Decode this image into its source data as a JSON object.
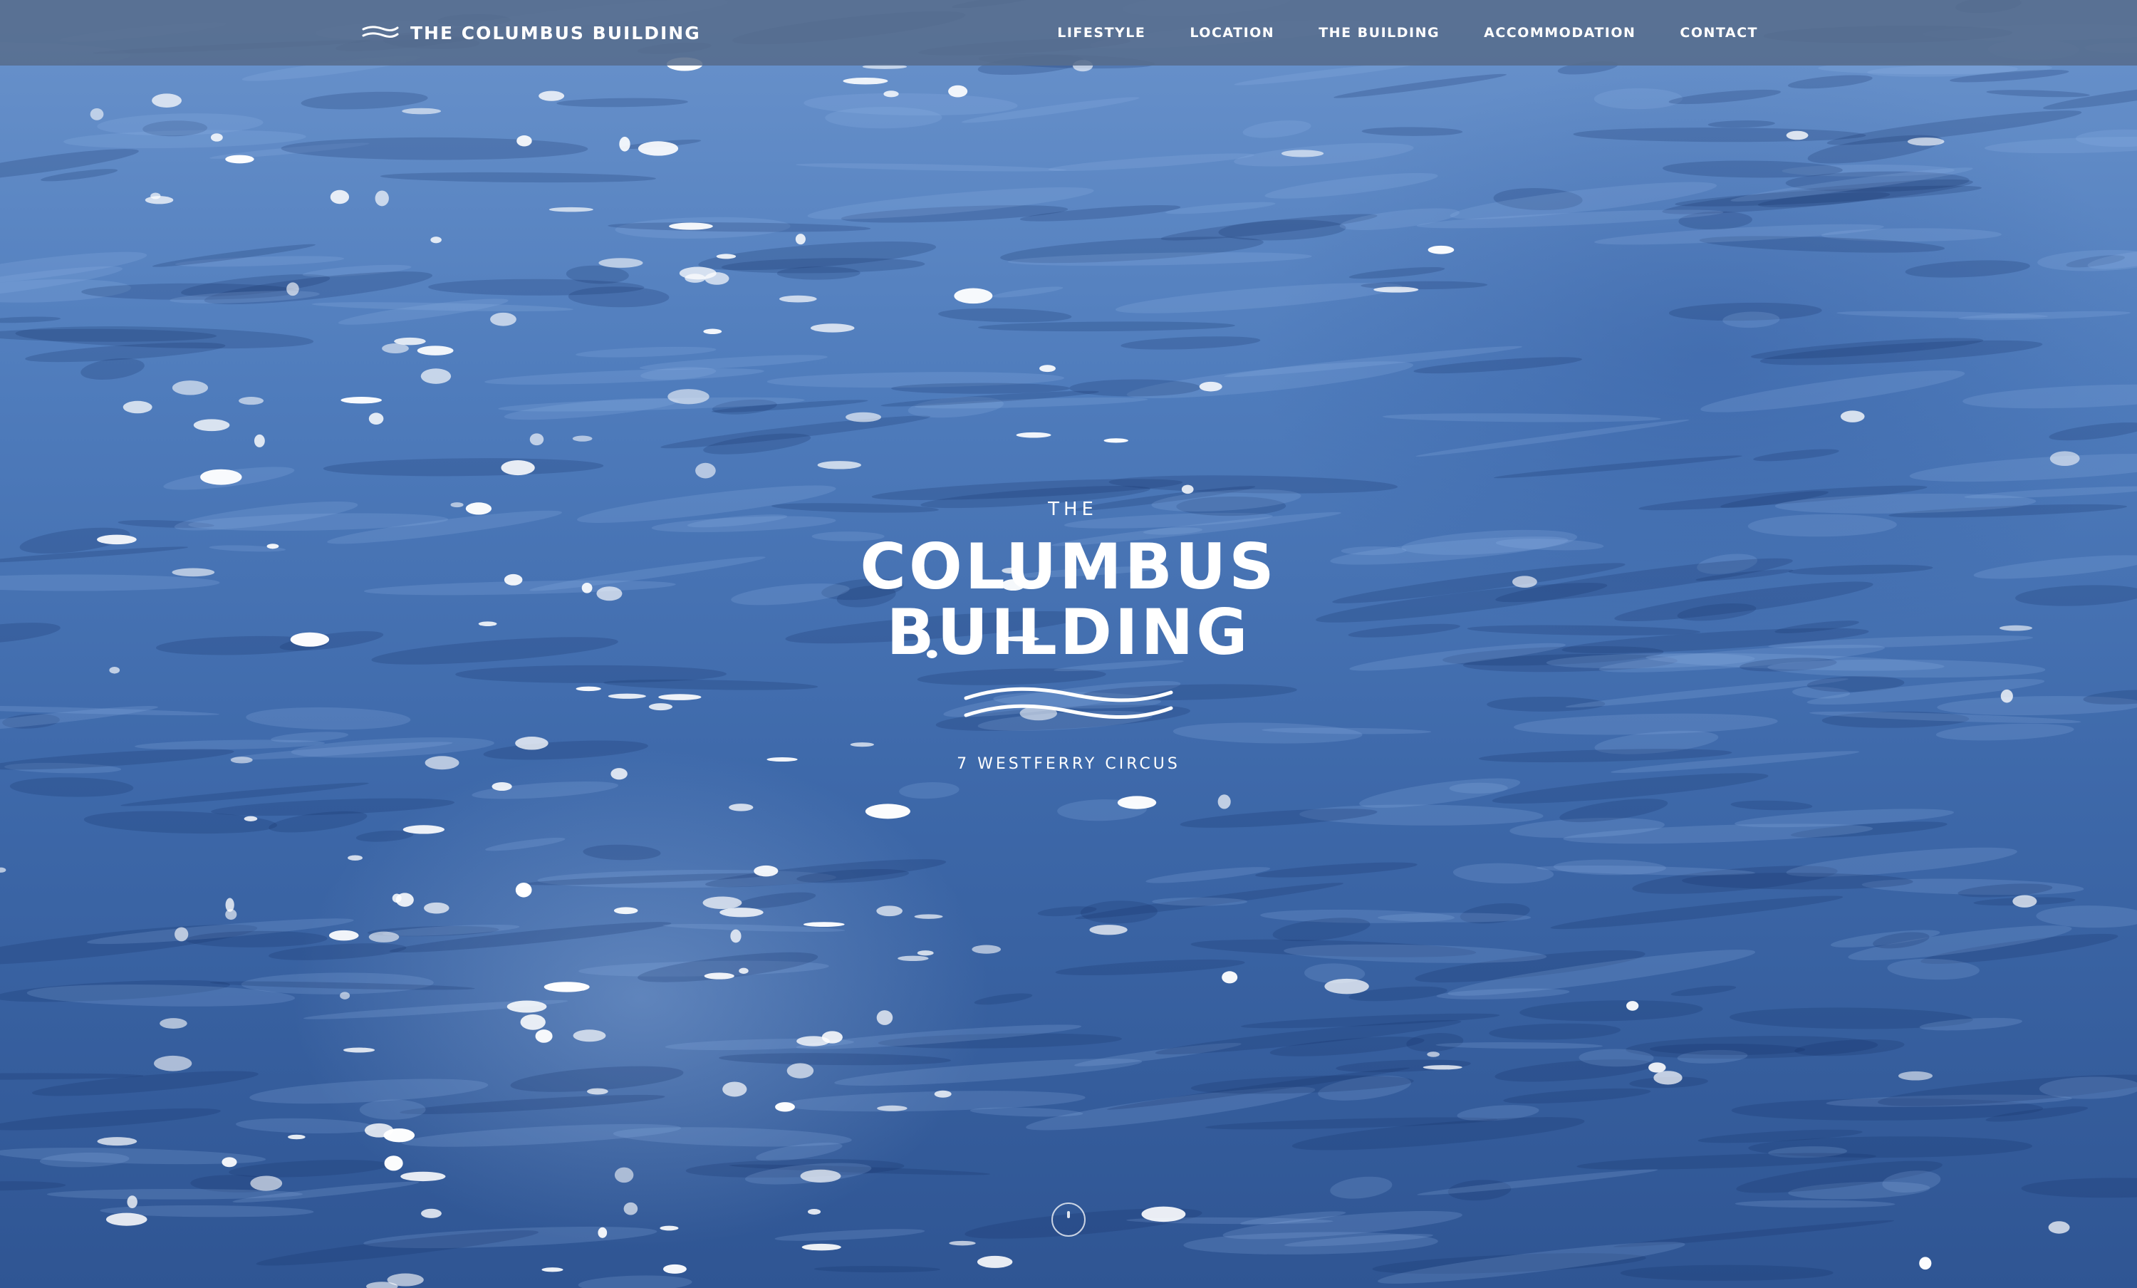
{
  "header": {
    "brand": "THE COLUMBUS BUILDING",
    "brand_icon": "wave-lines-icon",
    "nav": [
      {
        "label": "LIFESTYLE"
      },
      {
        "label": "LOCATION"
      },
      {
        "label": "THE BUILDING"
      },
      {
        "label": "ACCOMMODATION"
      },
      {
        "label": "CONTACT"
      }
    ]
  },
  "hero": {
    "background": "sparkling-water-video",
    "logo": {
      "the": "THE",
      "line1": "COLUMBUS",
      "line2": "BUILDING",
      "wave_icon": "wave-lines-icon"
    },
    "address": "7 WESTFERRY CIRCUS",
    "scroll_icon": "scroll-down-icon"
  },
  "colors": {
    "water": "#4f7cbc",
    "nav_bar": "#566c8c",
    "text": "#ffffff"
  }
}
